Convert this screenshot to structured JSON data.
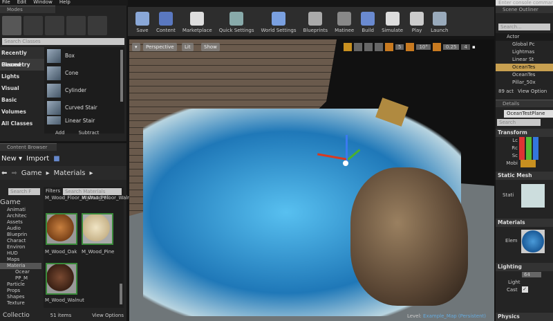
{
  "menu": [
    "File",
    "Edit",
    "Window",
    "Help"
  ],
  "modes": {
    "tab": "Modes",
    "search_placeholder": "Search Classes",
    "categories": [
      "Recently Placed",
      "Geometry",
      "Lights",
      "Visual",
      "Basic",
      "Volumes",
      "All Classes"
    ],
    "items": [
      "Box",
      "Cone",
      "Cylinder",
      "Curved Stair",
      "Linear Stair"
    ],
    "add": "Add",
    "subtract": "Subtract"
  },
  "content_browser": {
    "tab": "Content Browser",
    "new": "New",
    "import": "Import",
    "breadcrumb": [
      "Game",
      "Materials"
    ],
    "tree_search": "Search F",
    "filters": "Filters",
    "asset_search": "Search Materials",
    "tree": [
      "Game",
      "Animati",
      "Architec",
      "Assets",
      "Audio",
      "Blueprin",
      "Charact",
      "Environ",
      "HUD",
      "Maps",
      "Materia",
      "Ocear",
      "PP_M",
      "Particle",
      "Props",
      "Shapes",
      "Texture"
    ],
    "assets": [
      "M_Wood_Floor_Walnut_Poli",
      "M_Wood_Floor_Walnut_Wor",
      "M_Wood_Oak",
      "M_Wood_Pine",
      "M_Wood_Walnut"
    ],
    "collections": "Collectio",
    "count": "51 items",
    "view_options": "View Options"
  },
  "toolbar": [
    "Save",
    "Content",
    "Marketplace",
    "Quick Settings",
    "World Settings",
    "Blueprints",
    "Matinee",
    "Build",
    "Simulate",
    "Play",
    "Launch"
  ],
  "viewport": {
    "perspective": "Perspective",
    "lit": "Lit",
    "show": "Show",
    "grid": "5",
    "rot": "10°",
    "scale": "0.25",
    "cam": "4",
    "level_label": "Level:",
    "level": "Example_Map (Persistent)"
  },
  "outliner": {
    "console": "Enter console command",
    "tab": "Scene Outliner",
    "search": "Search...",
    "col": "Actor",
    "actors": [
      "Global Pc",
      "Lightmas",
      "Linear St",
      "OceanTes",
      "OceanTes",
      "Pillar_50x"
    ],
    "selected_index": 3,
    "count": "89 act",
    "view_options": "View Option"
  },
  "details": {
    "tab": "Details",
    "name": "OceanTestPlane",
    "search": "Search",
    "transform": "Transform",
    "rows": [
      "Lc",
      "Rc",
      "Sc"
    ],
    "mobility": "Mobi",
    "static_mesh": "Static Mesh",
    "static_label": "Stati",
    "materials": "Materials",
    "elem": "Elem",
    "lighting": "Lighting",
    "lm_value": "64",
    "light": "Light",
    "cast": "Cast",
    "physics": "Physics"
  }
}
